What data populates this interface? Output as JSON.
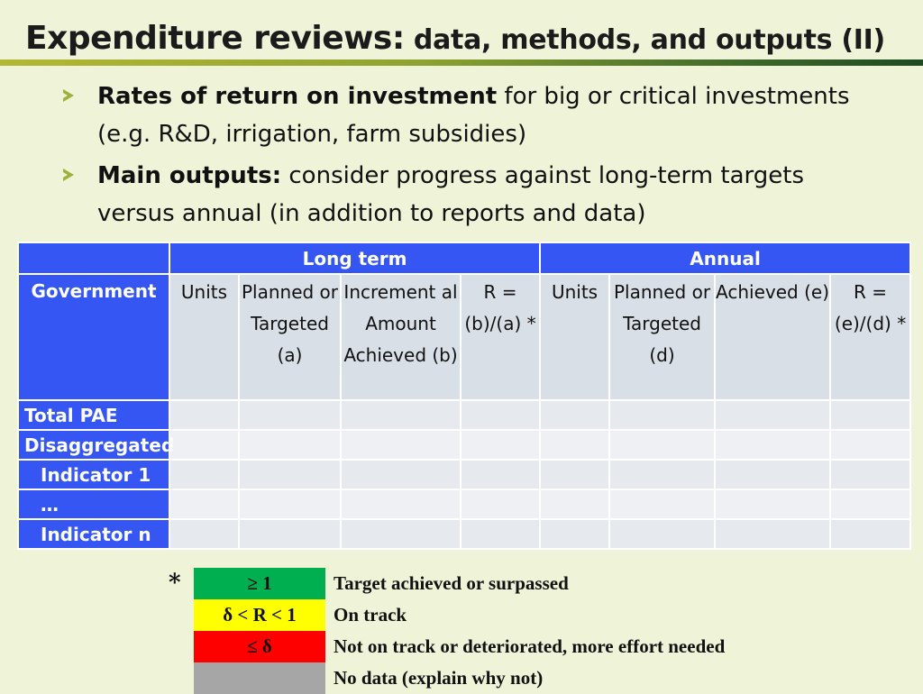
{
  "title": {
    "main": "Expenditure reviews:",
    "sub": " data, methods, and outputs (II)"
  },
  "bullets": [
    {
      "bold": "Rates of return on investment",
      "text": " for big or critical investments (e.g. R&D, irrigation, farm subsidies)"
    },
    {
      "bold": "Main outputs:",
      "text": " consider progress against long-term targets versus annual (in addition to reports and data)"
    }
  ],
  "table": {
    "groups": {
      "long_term": "Long term",
      "annual": "Annual"
    },
    "government": "Government",
    "columns": {
      "lt_units": "Units",
      "lt_planned": "Planned or Targeted (a)",
      "lt_increment": "Increment al Amount Achieved (b)",
      "lt_r": "R = (b)/(a) *",
      "an_units": "Units",
      "an_planned": "Planned or Targeted (d)",
      "an_achieved": "Achieved (e)",
      "an_r": "R = (e)/(d) *"
    },
    "rows": [
      "Total PAE",
      "Disaggregated",
      "Indicator 1",
      "…",
      "Indicator n"
    ]
  },
  "legend": {
    "star": "*",
    "items": [
      {
        "symbol": "≥ 1",
        "label": "Target achieved or surpassed",
        "color": "#00b050"
      },
      {
        "symbol": "δ < R < 1",
        "label": "On track",
        "color": "#ffff00"
      },
      {
        "symbol": "≤ δ",
        "label": "Not on track or deteriorated, more effort needed",
        "color": "#ff0000"
      },
      {
        "symbol": "",
        "label": "No data (explain why not)",
        "color": "#a6a6a6"
      }
    ]
  }
}
